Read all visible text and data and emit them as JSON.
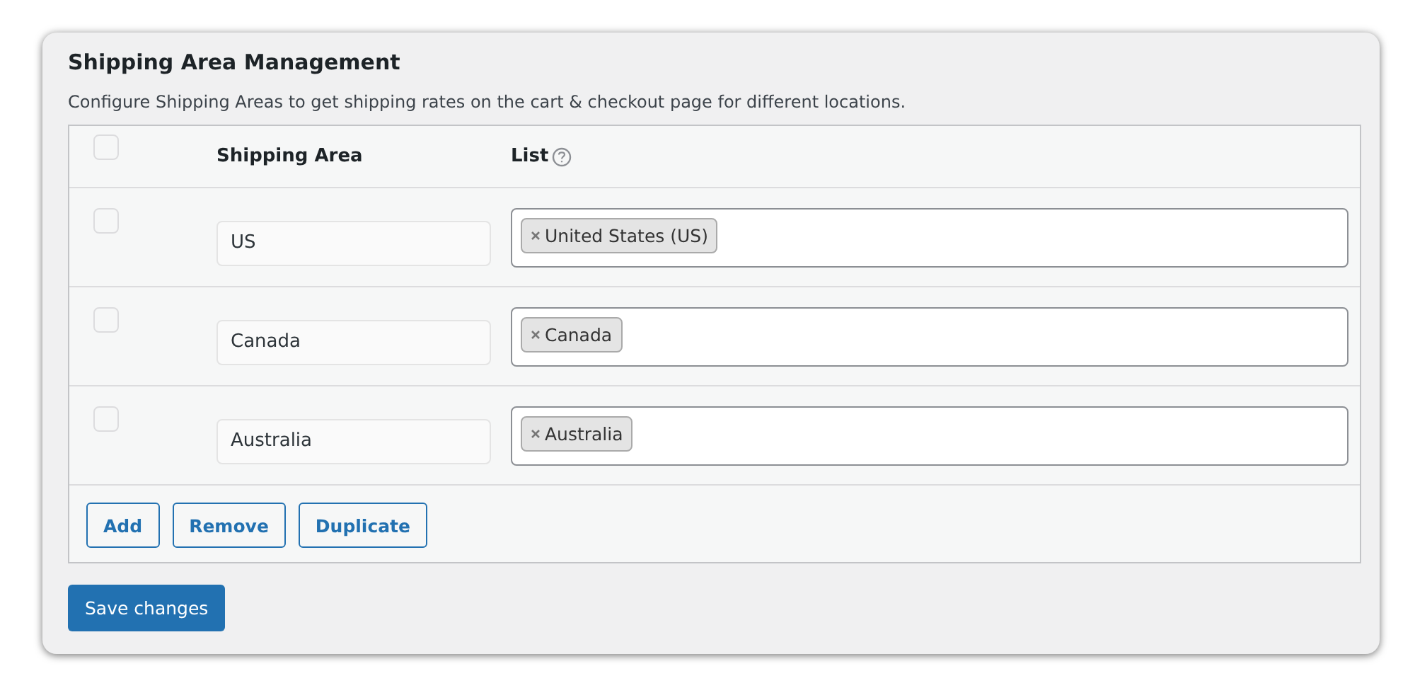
{
  "title": "Shipping Area Management",
  "description": "Configure Shipping Areas to get shipping rates on the cart & checkout page for different locations.",
  "table": {
    "select_all": {
      "checked": false
    },
    "columns": [
      "Shipping Area",
      "List"
    ],
    "rows": [
      {
        "checked": false,
        "area": "US",
        "list": [
          "United States (US)"
        ]
      },
      {
        "checked": false,
        "area": "Canada",
        "list": [
          "Canada"
        ]
      },
      {
        "checked": false,
        "area": "Australia",
        "list": [
          "Australia"
        ]
      }
    ],
    "buttons": [
      "Add",
      "Remove",
      "Duplicate"
    ]
  },
  "save_button": "Save changes"
}
